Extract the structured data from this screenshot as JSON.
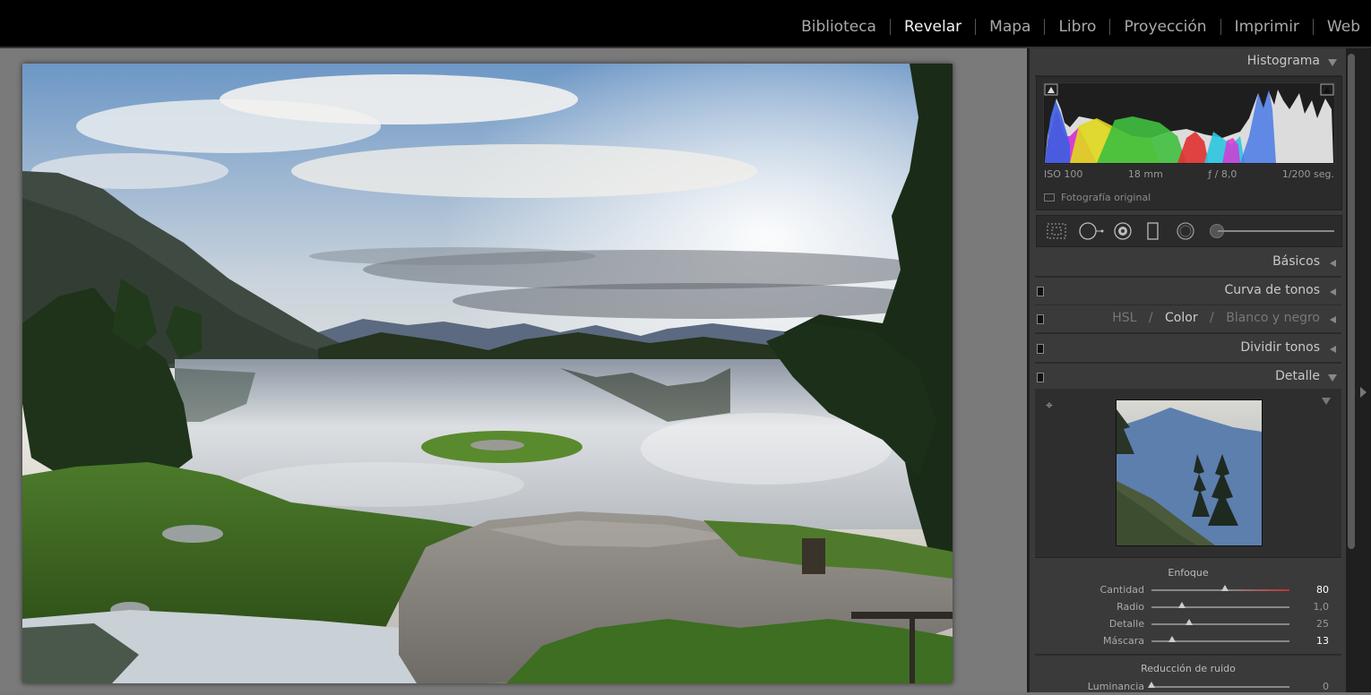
{
  "module_picker": {
    "items": [
      {
        "label": "Biblioteca"
      },
      {
        "label": "Revelar"
      },
      {
        "label": "Mapa"
      },
      {
        "label": "Libro"
      },
      {
        "label": "Proyección"
      },
      {
        "label": "Imprimir"
      },
      {
        "label": "Web"
      }
    ],
    "active": "Revelar"
  },
  "histogram": {
    "title": "Histograma",
    "exif": {
      "iso": "ISO 100",
      "focal": "18 mm",
      "aperture": "ƒ / 8,0",
      "shutter": "1/200 seg."
    },
    "original_label": "Fotografía original"
  },
  "panels": {
    "basicos": "Básicos",
    "curva": "Curva de tonos",
    "hsl": {
      "hsl": "HSL",
      "sep": "/",
      "color": "Color",
      "bw": "Blanco y negro"
    },
    "dividir": "Dividir tonos",
    "detalle": "Detalle"
  },
  "enfoque": {
    "title": "Enfoque",
    "rows": [
      {
        "label": "Cantidad",
        "value": "80",
        "level": 0.53
      },
      {
        "label": "Radio",
        "value": "1,0",
        "level": 0.22
      },
      {
        "label": "Detalle",
        "value": "25",
        "level": 0.27
      },
      {
        "label": "Máscara",
        "value": "13",
        "level": 0.15
      }
    ]
  },
  "ruido": {
    "title": "Reducción de ruido",
    "rows": [
      {
        "label": "Luminancia",
        "value": "0",
        "level": 0.0
      }
    ]
  },
  "colors": {
    "panel_bg": "#3a3a3a",
    "topbar": "#000000",
    "canvas": "#7a7a7a"
  }
}
